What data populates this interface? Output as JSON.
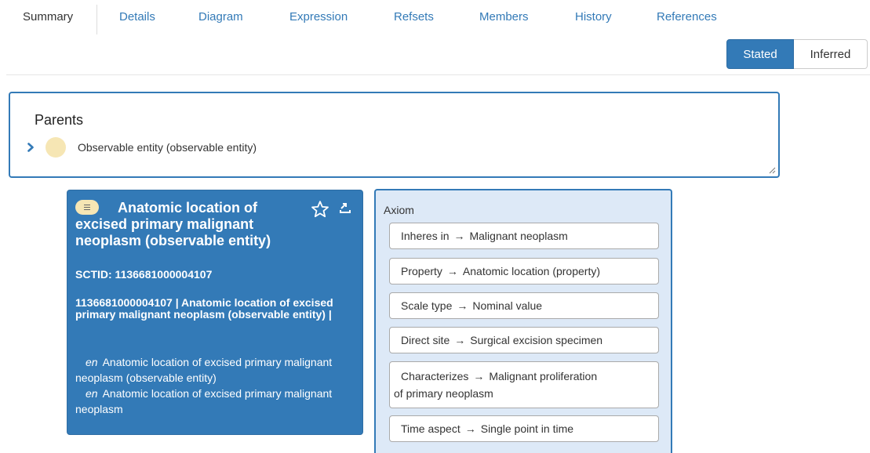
{
  "tabs": [
    {
      "label": "Summary",
      "active": true
    },
    {
      "label": "Details"
    },
    {
      "label": "Diagram"
    },
    {
      "label": "Expression"
    },
    {
      "label": "Refsets"
    },
    {
      "label": "Members"
    },
    {
      "label": "History"
    },
    {
      "label": "References"
    }
  ],
  "view_toggle": {
    "stated": "Stated",
    "inferred": "Inferred",
    "selected": "Stated"
  },
  "parents": {
    "title": "Parents",
    "items": [
      {
        "label": "Observable entity (observable entity)"
      }
    ]
  },
  "concept": {
    "title": "Anatomic location of excised primary malignant neoplasm (observable entity)",
    "sctid_line": "SCTID: 1136681000004107",
    "fsn_line": "1136681000004107 | Anatomic location of excised primary malignant neoplasm (observable entity) |",
    "descriptions": [
      {
        "lang": "en",
        "text": "Anatomic location of excised primary malignant neoplasm (observable entity)"
      },
      {
        "lang": "en",
        "text": "Anatomic location of excised primary malignant neoplasm"
      }
    ]
  },
  "axiom": {
    "title": "Axiom",
    "arrow": "→",
    "relationships": [
      {
        "type": "Inheres in",
        "target": "Malignant neoplasm"
      },
      {
        "type": "Property",
        "target": "Anatomic location (property)"
      },
      {
        "type": "Scale type",
        "target": "Nominal value"
      },
      {
        "type": "Direct site",
        "target": "Surgical excision specimen"
      },
      {
        "type": "Characterizes",
        "target": "Malignant proliferation",
        "target_cont": "of primary neoplasm"
      },
      {
        "type": "Time aspect",
        "target": "Single point in time"
      }
    ]
  },
  "colors": {
    "primary": "#337ab7",
    "link": "#337ab7",
    "concept_badge": "#f6e6b4",
    "axiom_bg": "#dde9f7"
  },
  "icons": [
    "chevron-right-icon",
    "star-outline-icon",
    "export-icon",
    "definition-status-icon"
  ]
}
